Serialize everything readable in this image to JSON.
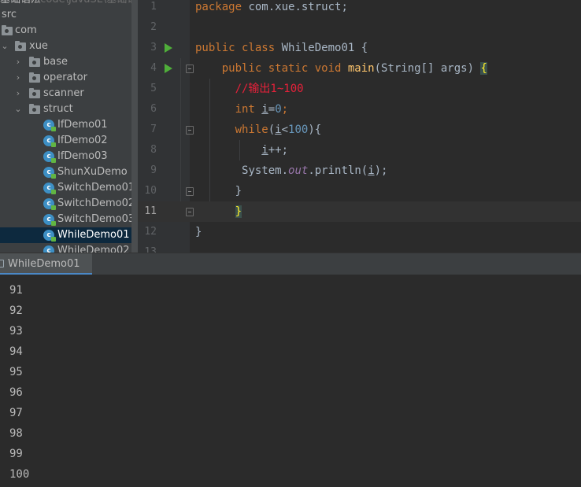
{
  "project_tree": {
    "partial_header": "T:\\code\\JavaSE\\基础语法",
    "items": [
      {
        "label": "src",
        "kind": "root"
      },
      {
        "label": "com",
        "kind": "package"
      },
      {
        "label": "xue",
        "kind": "package",
        "expanded": true
      },
      {
        "label": "base",
        "kind": "package",
        "expanded": false
      },
      {
        "label": "operator",
        "kind": "package",
        "expanded": false
      },
      {
        "label": "scanner",
        "kind": "package",
        "expanded": false
      },
      {
        "label": "struct",
        "kind": "package",
        "expanded": true
      },
      {
        "label": "IfDemo01",
        "kind": "class"
      },
      {
        "label": "IfDemo02",
        "kind": "class"
      },
      {
        "label": "IfDemo03",
        "kind": "class"
      },
      {
        "label": "ShunXuDemo",
        "kind": "class"
      },
      {
        "label": "SwitchDemo01",
        "kind": "class"
      },
      {
        "label": "SwitchDemo02",
        "kind": "class"
      },
      {
        "label": "SwitchDemo03",
        "kind": "class"
      },
      {
        "label": "WhileDemo01",
        "kind": "class",
        "selected": true
      },
      {
        "label": "WhileDemo02",
        "kind": "class",
        "partial": true
      }
    ]
  },
  "editor": {
    "line_numbers": [
      "1",
      "2",
      "3",
      "4",
      "5",
      "6",
      "7",
      "8",
      "9",
      "10",
      "11",
      "12",
      "13"
    ],
    "current_line": "11",
    "tokens": {
      "l1_kw": "package",
      "l1_rest": " com.xue.struct;",
      "l3_kw": "public class",
      "l3_rest": " WhileDemo01 {",
      "l4_kw": "public static void",
      "l4_fn": "main",
      "l4_rest": "(String[] args) ",
      "l4_brace": "{",
      "l5_comment": "//输出1~100",
      "l6_kw": "int",
      "l6_var": "i",
      "l6_eq": "=",
      "l6_num": "0",
      "l6_semi": ";",
      "l7_kw": "while",
      "l7_open": "(",
      "l7_var": "i",
      "l7_lt": "<",
      "l7_num": "100",
      "l7_close": "){",
      "l8_var": "i",
      "l8_rest": "++;",
      "l9_pre": "System.",
      "l9_field": "out",
      "l9_mid": ".println(",
      "l9_var": "i",
      "l9_end": ");",
      "l10": "}",
      "l11": "}",
      "l12": "}"
    }
  },
  "run_panel": {
    "tab_label": "WhileDemo01",
    "output": [
      "91",
      "92",
      "93",
      "94",
      "95",
      "96",
      "97",
      "98",
      "99",
      "100"
    ]
  },
  "colors": {
    "keyword": "#cc7832",
    "method": "#ffc66d",
    "number": "#6897bb",
    "comment": "#e8213a",
    "field": "#9876aa",
    "selection": "#0d293e",
    "run_icon": "#4fae3a"
  }
}
